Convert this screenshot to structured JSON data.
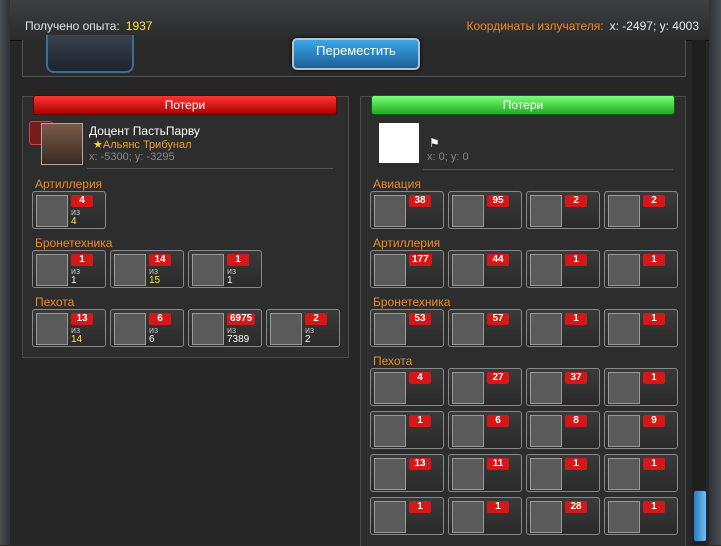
{
  "header": {
    "xp_label": "Получено опыта:",
    "xp_value": "1937",
    "coords_label": "Координаты излучателя:",
    "coords_value": "x: -2497; y: 4003",
    "move_button": "Переместить"
  },
  "left": {
    "title": "Потери",
    "player_name": "Доцент ПастьПарву",
    "alliance": "Альянс Трибунал",
    "coords": "x: -5300; y: -3295",
    "iz": "из",
    "categories": [
      {
        "label": "Артиллерия",
        "units": [
          {
            "loss": "4",
            "total": "4",
            "yellow": true
          }
        ]
      },
      {
        "label": "Бронетехника",
        "units": [
          {
            "loss": "1",
            "total": "1",
            "yellow": false
          },
          {
            "loss": "14",
            "total": "15",
            "yellow": true
          },
          {
            "loss": "1",
            "total": "1",
            "yellow": false
          }
        ]
      },
      {
        "label": "Пехота",
        "units": [
          {
            "loss": "13",
            "total": "14",
            "yellow": true
          },
          {
            "loss": "6",
            "total": "6",
            "yellow": false
          },
          {
            "loss": "6975",
            "total": "7389",
            "yellow": false
          },
          {
            "loss": "2",
            "total": "2",
            "yellow": false
          }
        ]
      }
    ]
  },
  "right": {
    "title": "Потери",
    "coords": "x: 0; y: 0",
    "categories": [
      {
        "label": "Авиация",
        "units": [
          "38",
          "95",
          "2",
          "2"
        ]
      },
      {
        "label": "Артиллерия",
        "units": [
          "177",
          "44",
          "1",
          "1"
        ]
      },
      {
        "label": "Бронетехника",
        "units": [
          "53",
          "57",
          "1",
          "1"
        ]
      },
      {
        "label": "Пехота",
        "units": [
          "4",
          "27",
          "37",
          "1",
          "1",
          "6",
          "8",
          "9",
          "13",
          "11",
          "1",
          "1",
          "1",
          "1",
          "28",
          "1"
        ]
      }
    ]
  },
  "colors": {
    "accent": "#f08a24",
    "loss_badge": "#d41818",
    "yellow": "#ffe44a"
  }
}
